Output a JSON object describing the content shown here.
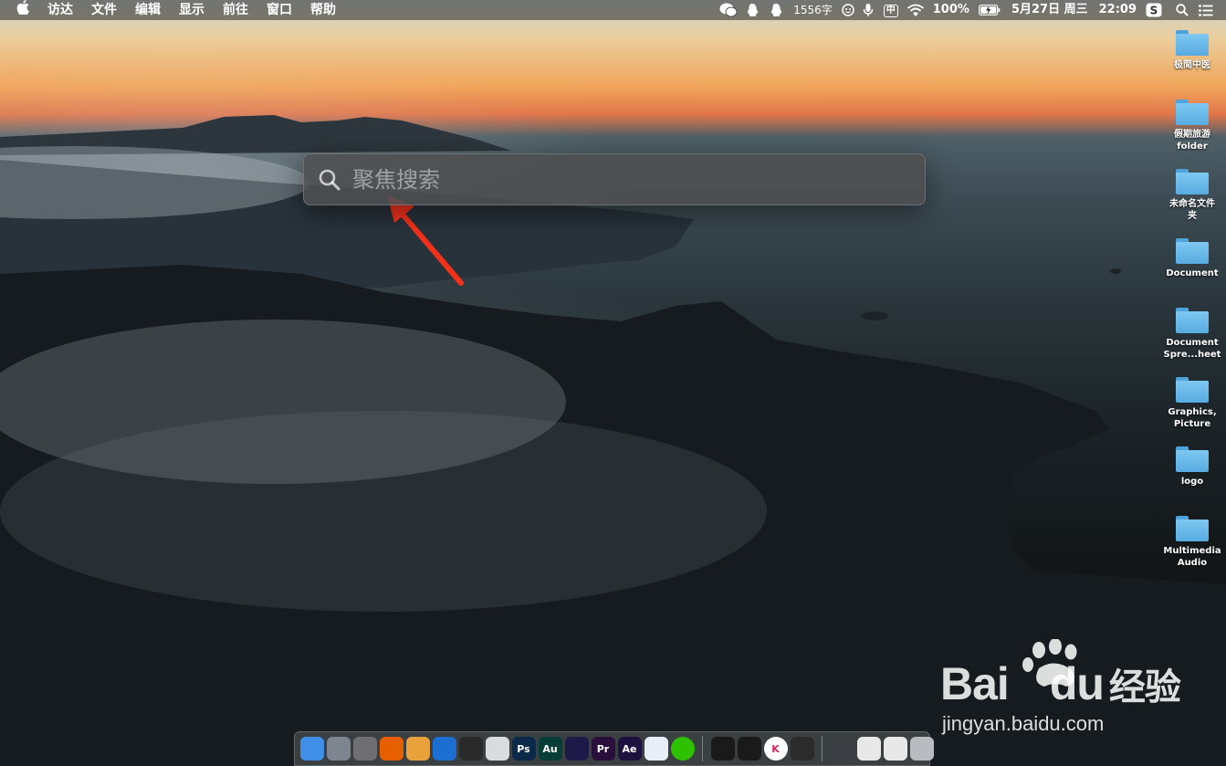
{
  "menubar": {
    "apple": "",
    "menus": [
      "访达",
      "文件",
      "编辑",
      "显示",
      "前往",
      "窗口",
      "帮助"
    ],
    "status": {
      "char_count": "1556字",
      "input_method": "中",
      "battery": "100%",
      "date": "5月27日 周三",
      "time": "22:09"
    }
  },
  "spotlight": {
    "placeholder": "聚焦搜索",
    "value": ""
  },
  "desktop_icons": [
    "极简中医",
    "假期旅游\nfolder",
    "未命名文件\n夹",
    "Document",
    "Document\nSpre...heet",
    "Graphics,\nPicture",
    "logo",
    "Multimedia\nAudio"
  ],
  "dock": {
    "apps": [
      {
        "name": "finder-icon",
        "label": "",
        "color": "#3f8ee8"
      },
      {
        "name": "launchpad-icon",
        "label": "",
        "color": "#7d8590"
      },
      {
        "name": "system-preferences-icon",
        "label": "",
        "color": "#6e6e73"
      },
      {
        "name": "firefox-icon",
        "label": "",
        "color": "#e66000"
      },
      {
        "name": "chrome-icon",
        "label": "",
        "color": "#e9a23b"
      },
      {
        "name": "quicktime-icon",
        "label": "",
        "color": "#1c6fd1"
      },
      {
        "name": "final-cut-icon",
        "label": "",
        "color": "#2a2a2a"
      },
      {
        "name": "preview-icon",
        "label": "",
        "color": "#d9dcdf"
      },
      {
        "name": "photoshop-icon",
        "label": "Ps",
        "color": "#0b2a4a"
      },
      {
        "name": "audition-icon",
        "label": "Au",
        "color": "#063d36"
      },
      {
        "name": "media-encoder-icon",
        "label": "",
        "color": "#1d1a4a"
      },
      {
        "name": "premiere-icon",
        "label": "Pr",
        "color": "#2a0e3c"
      },
      {
        "name": "after-effects-icon",
        "label": "Ae",
        "color": "#1d1140"
      },
      {
        "name": "baidu-netdisk-icon",
        "label": "",
        "color": "#e8eef7"
      },
      {
        "name": "wechat-icon",
        "label": "",
        "color": "#2dc100"
      },
      {
        "name": "qq-icon",
        "label": "",
        "color": "#1a1a1a"
      },
      {
        "name": "qq-alt-icon",
        "label": "",
        "color": "#1a1a1a"
      },
      {
        "name": "k-app-icon",
        "label": "K",
        "color": "#ffffff"
      },
      {
        "name": "screenshot-app-icon",
        "label": "",
        "color": "#2b2b2b"
      },
      {
        "name": "minimized-window-1-icon",
        "label": "",
        "color": "#3c4045"
      },
      {
        "name": "minimized-window-2-icon",
        "label": "",
        "color": "#e8e8e8"
      },
      {
        "name": "minimized-window-3-icon",
        "label": "",
        "color": "#e8e8e8"
      },
      {
        "name": "trash-icon",
        "label": "",
        "color": "#b8bcc0"
      }
    ]
  },
  "watermark": {
    "brand": "Bai",
    "brand2": "du",
    "suffix": "经验",
    "url": "jingyan.baidu.com"
  },
  "colors": {
    "arrow": "#f2311b",
    "folder": "#6ab9ea"
  }
}
